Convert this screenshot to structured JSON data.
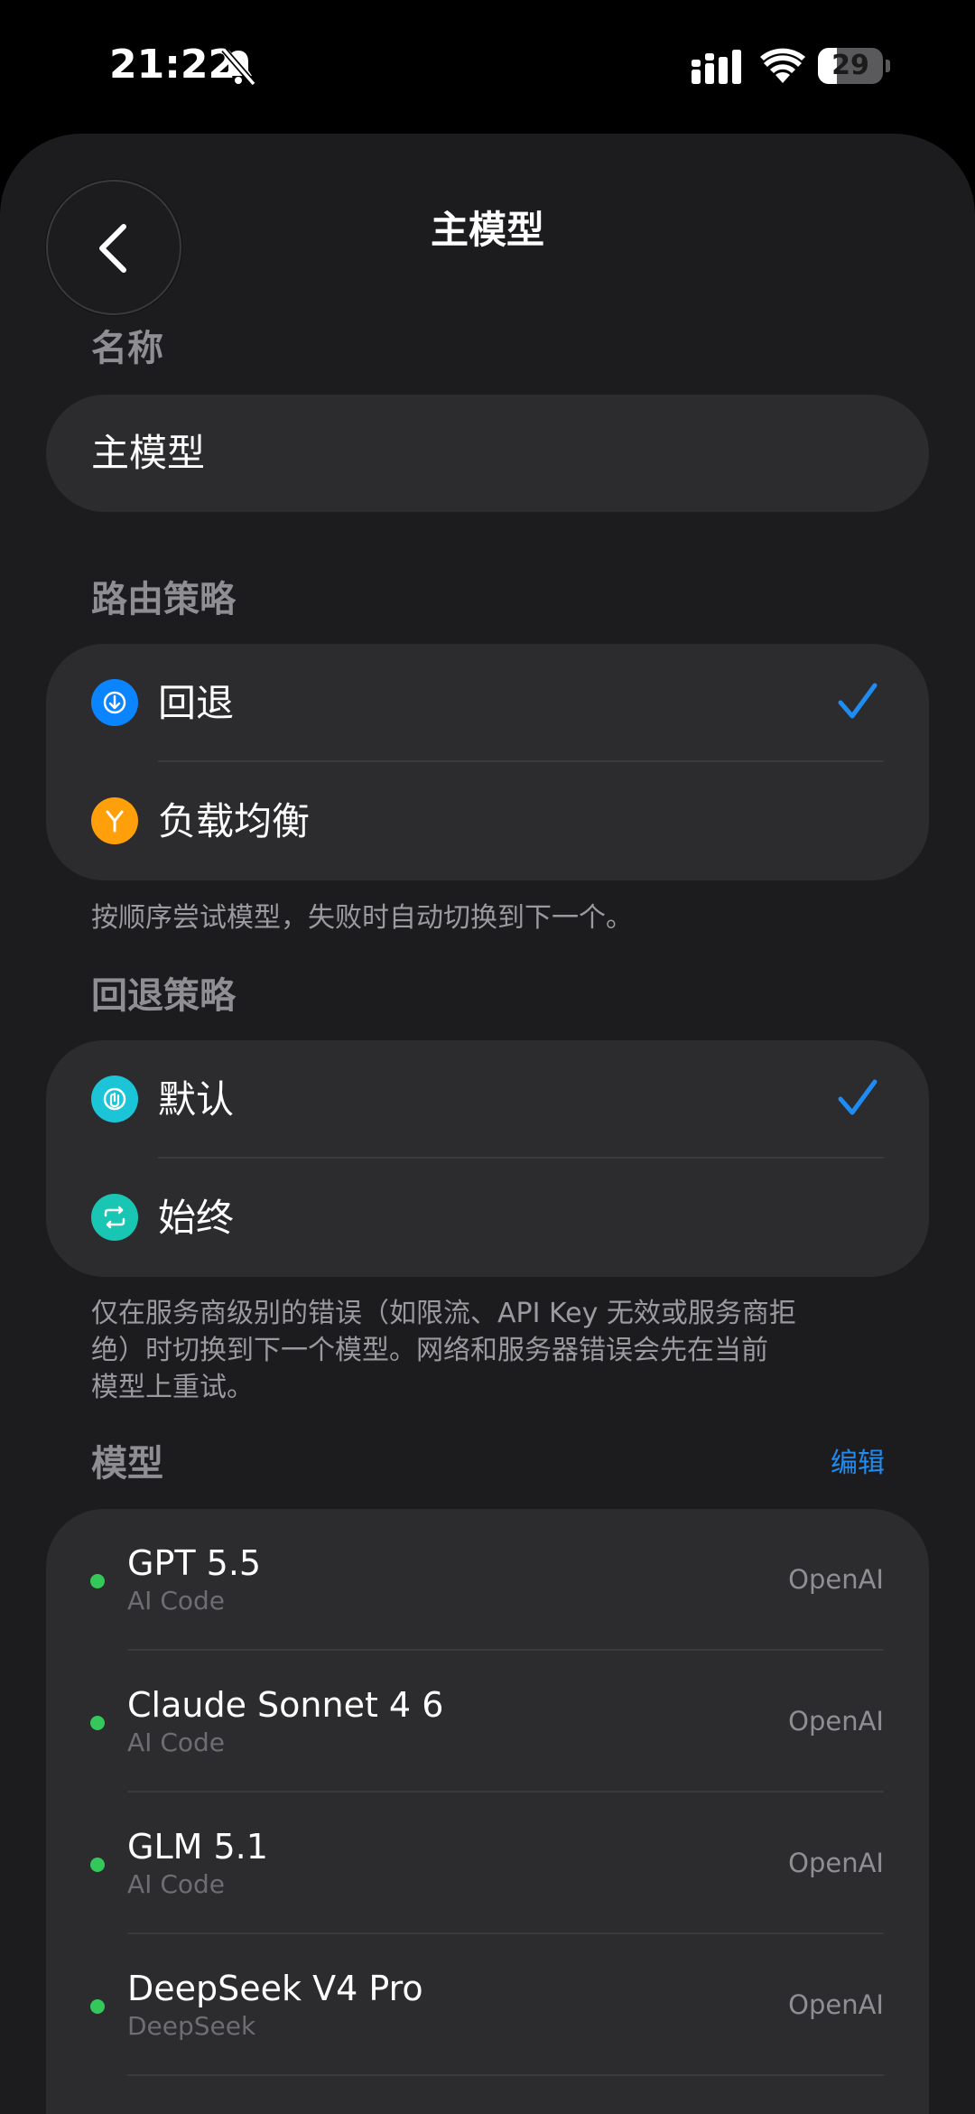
{
  "status_bar": {
    "time": "21:22",
    "battery_level": "29",
    "battery_fraction": 0.29
  },
  "nav": {
    "title": "主模型",
    "back_icon": "chevron-left-icon"
  },
  "name_section": {
    "label": "名称",
    "value": "主模型"
  },
  "routing_section": {
    "label": "路由策略",
    "options": [
      {
        "label": "回退",
        "icon": "fallback-icon",
        "color": "#0a84ff",
        "selected": true
      },
      {
        "label": "负载均衡",
        "icon": "load-balance-icon",
        "color": "#ff9f0a",
        "selected": false
      }
    ],
    "footnote": "按顺序尝试模型，失败时自动切换到下一个。"
  },
  "fallback_section": {
    "label": "回退策略",
    "options": [
      {
        "label": "默认",
        "icon": "default-icon",
        "color": "#1cc4d8",
        "selected": true
      },
      {
        "label": "始终",
        "icon": "repeat-icon",
        "color": "#19c6b3",
        "selected": false
      }
    ],
    "footnote_lines": [
      "仅在服务商级别的错误（如限流、API Key 无效或服务商拒",
      "绝）时切换到下一个模型。网络和服务器错误会先在当前",
      "模型上重试。"
    ]
  },
  "models_section": {
    "label": "模型",
    "edit_label": "编辑",
    "models": [
      {
        "name": "GPT 5.5",
        "source": "AI Code",
        "provider": "OpenAI",
        "status_color": "#34c759"
      },
      {
        "name": "Claude Sonnet 4 6",
        "source": "AI Code",
        "provider": "OpenAI",
        "status_color": "#34c759"
      },
      {
        "name": "GLM 5.1",
        "source": "AI Code",
        "provider": "OpenAI",
        "status_color": "#34c759"
      },
      {
        "name": "DeepSeek V4 Pro",
        "source": "DeepSeek",
        "provider": "OpenAI",
        "status_color": "#34c759"
      }
    ]
  },
  "colors": {
    "accent": "#1e8cf3",
    "background": "#1c1c1e",
    "card": "#2c2c2e"
  }
}
